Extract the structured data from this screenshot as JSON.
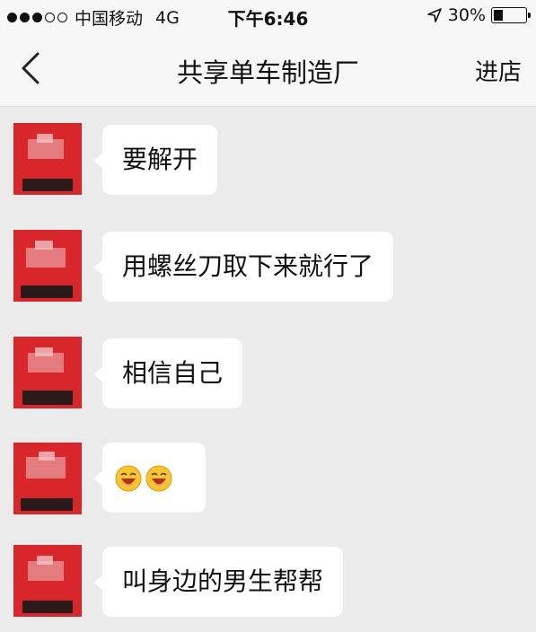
{
  "status_bar": {
    "carrier": "中国移动",
    "network": "4G",
    "time": "下午6:46",
    "battery_percent": "30%",
    "battery_level": 0.3,
    "signal_bars_filled": 3,
    "signal_bars_total": 5
  },
  "nav": {
    "back_icon": "chevron-left-icon",
    "title": "共享单车制造厂",
    "action_label": "进店"
  },
  "messages": [
    {
      "text": "要解开"
    },
    {
      "text": "用螺丝刀取下来就行了"
    },
    {
      "text": "相信自己"
    },
    {
      "text": "",
      "emoji": [
        "laughing-face-emoji",
        "laughing-face-emoji"
      ]
    },
    {
      "text": "叫身边的男生帮帮"
    }
  ],
  "colors": {
    "background": "#ebebeb",
    "bubble": "#ffffff",
    "avatar_red": "#d8262b"
  }
}
